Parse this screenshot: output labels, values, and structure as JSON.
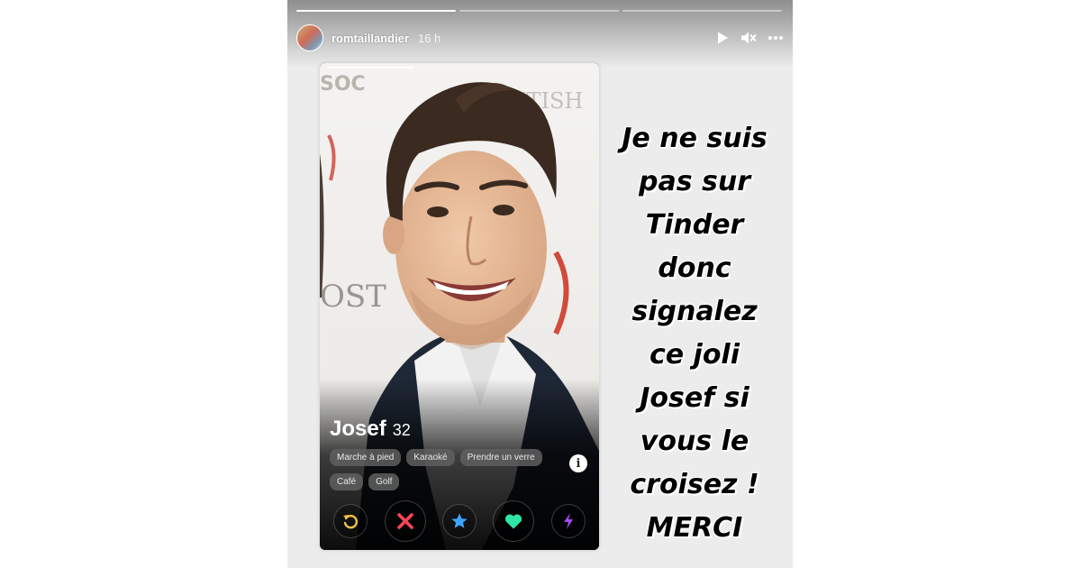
{
  "story": {
    "username": "romtaillandier",
    "timestamp": "16 h",
    "progress_segments": [
      {
        "state": "done"
      },
      {
        "state": "pending"
      },
      {
        "state": "pending"
      }
    ],
    "icons": {
      "play": "play-icon",
      "mute": "muted-speaker-icon",
      "more": "more-dots-icon"
    }
  },
  "profile_card": {
    "name": "Josef",
    "age": "32",
    "tags": [
      "Marche à pied",
      "Karaoké",
      "Prendre un verre",
      "Café",
      "Golf"
    ],
    "info_label": "i",
    "photo_segments": [
      {
        "state": "done"
      },
      {
        "state": "pending"
      },
      {
        "state": "pending"
      }
    ],
    "actions": [
      {
        "name": "rewind-icon",
        "size": "sm",
        "color": "#f4c24a"
      },
      {
        "name": "nope-icon",
        "size": "lg",
        "color": "#ff4458"
      },
      {
        "name": "super-like-icon",
        "size": "sm",
        "color": "#3ca4ff"
      },
      {
        "name": "like-heart-icon",
        "size": "lg",
        "color": "#2fe5a7"
      },
      {
        "name": "boost-icon",
        "size": "sm",
        "color": "#a64bf4"
      }
    ]
  },
  "caption": {
    "lines": [
      "Je ne suis",
      "pas sur",
      "Tinder",
      "donc",
      "signalez",
      "ce joli",
      "Josef si",
      "vous le",
      "croisez !",
      "MERCI"
    ]
  }
}
